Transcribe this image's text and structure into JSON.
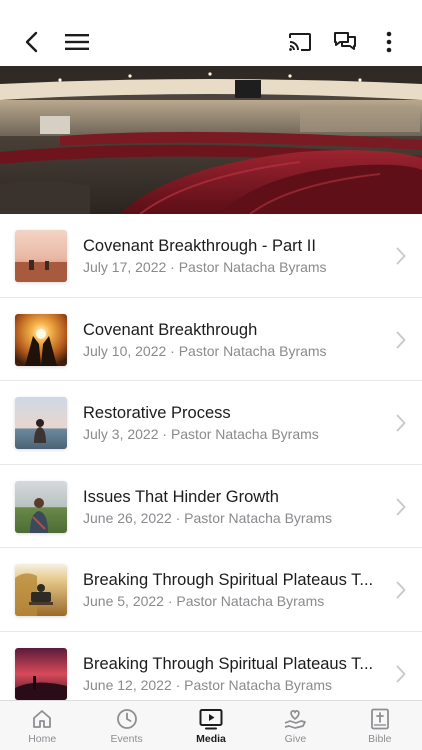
{
  "header": {
    "back_icon": "chevron-left-icon",
    "menu_icon": "hamburger-menu-icon",
    "cast_icon": "cast-icon",
    "chat_icon": "chat-bubbles-icon",
    "more_icon": "more-vertical-icon"
  },
  "hero": {
    "image": "church auditorium with red seats"
  },
  "sermons": [
    {
      "title": "Covenant Breakthrough - Part II",
      "meta": "July 17, 2022 · Pastor Natacha Byrams",
      "thumb": "field-sunset"
    },
    {
      "title": "Covenant Breakthrough",
      "meta": "July 10, 2022 · Pastor Natacha Byrams",
      "thumb": "hands-sun"
    },
    {
      "title": "Restorative Process",
      "meta": "July 3, 2022 · Pastor Natacha Byrams",
      "thumb": "woman-sea"
    },
    {
      "title": "Issues That Hinder Growth",
      "meta": "June 26, 2022 · Pastor Natacha Byrams",
      "thumb": "man-field"
    },
    {
      "title": "Breaking Through Spiritual Plateaus T...",
      "meta": "June 5, 2022 · Pastor Natacha Byrams",
      "thumb": "bench-autumn"
    },
    {
      "title": "Breaking Through Spiritual Plateaus T...",
      "meta": "June 12, 2022 · Pastor Natacha Byrams",
      "thumb": "red-sky"
    }
  ],
  "tabs": [
    {
      "label": "Home",
      "icon": "home-icon",
      "active": false
    },
    {
      "label": "Events",
      "icon": "clock-icon",
      "active": false
    },
    {
      "label": "Media",
      "icon": "tv-play-icon",
      "active": true
    },
    {
      "label": "Give",
      "icon": "heart-hand-icon",
      "active": false
    },
    {
      "label": "Bible",
      "icon": "bible-cross-icon",
      "active": false
    }
  ],
  "colors": {
    "active_tab": "#1c1c1e",
    "inactive_tab": "#8e8e93",
    "seat_red": "#8b1a24"
  }
}
